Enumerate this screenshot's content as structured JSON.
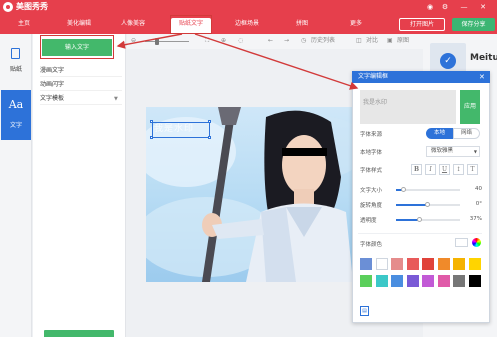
{
  "app": {
    "title": "美图秀秀",
    "window_icons": [
      "help",
      "settings",
      "minimize",
      "close"
    ]
  },
  "tabs": [
    {
      "label": "主页"
    },
    {
      "label": "美化编辑"
    },
    {
      "label": "人像美容"
    },
    {
      "label": "贴纸文字"
    },
    {
      "label": "边框场景"
    },
    {
      "label": "拼图"
    },
    {
      "label": "更多"
    }
  ],
  "header_buttons": {
    "open_image": "打开图片",
    "save_share": "保存分享"
  },
  "sidebar": {
    "sticker": "贴纸",
    "text_icon": "Aa",
    "text": "文字"
  },
  "text_panel": {
    "input_text_button": "输入文字",
    "items": [
      "漫画文字",
      "动画闪字",
      "文字模板"
    ]
  },
  "toolbar": {
    "history": "历史列表",
    "compare": "对比",
    "original": "原图"
  },
  "canvas": {
    "watermark_text": "我是水印"
  },
  "right_panel": {
    "label": "Meitu"
  },
  "dialog": {
    "title": "文字编辑框",
    "placeholder": "我是水印",
    "apply_button": "应用",
    "font_source_label": "字体来源",
    "font_source_options": [
      "本地",
      "网络"
    ],
    "local_font_label": "本地字体",
    "local_font_value": "微软雅黑",
    "font_style_label": "字体样式",
    "style_buttons": [
      "B",
      "I",
      "U",
      "↕",
      "T"
    ],
    "size_label": "文字大小",
    "size_value": "40",
    "size_fraction": 0.12,
    "rotation_label": "旋转角度",
    "rotation_value": "0°",
    "rotation_fraction": 0.5,
    "opacity_label": "透明度",
    "opacity_value": "37%",
    "opacity_fraction": 0.37,
    "color_label": "字体颜色",
    "swatches": [
      "#6b8fd6",
      "#ffffff",
      "#e58c8c",
      "#e85a5a",
      "#e0433a",
      "#f08a2a",
      "#f5b300",
      "#ffd400",
      "#5bcf5b",
      "#3cc8c8",
      "#4a8ee0",
      "#7a5ad6",
      "#c25ad6",
      "#e05aa8",
      "#777777",
      "#000000"
    ]
  }
}
